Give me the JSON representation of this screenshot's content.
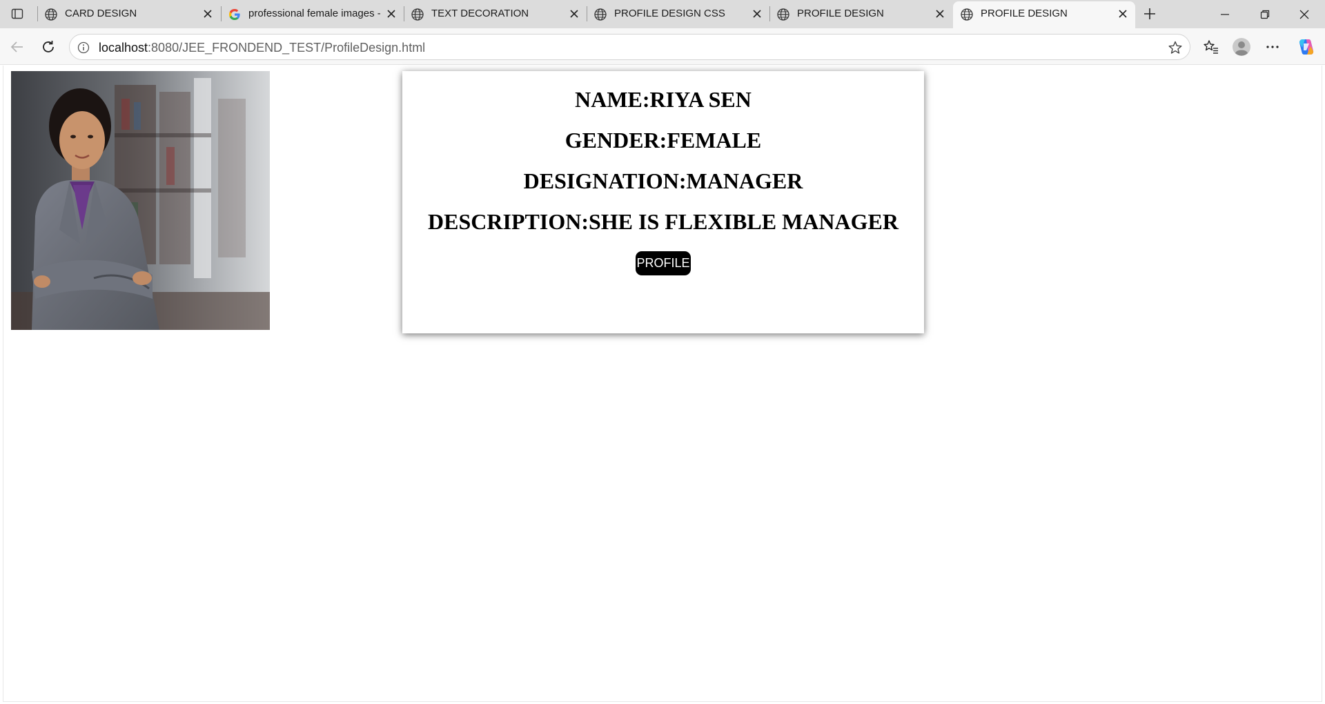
{
  "browser": {
    "tabs": [
      {
        "title": "CARD DESIGN",
        "icon": "globe-icon",
        "active": false
      },
      {
        "title": "professional female images - Google Search",
        "icon": "google-icon",
        "active": false
      },
      {
        "title": "TEXT DECORATION",
        "icon": "globe-icon",
        "active": false
      },
      {
        "title": "PROFILE DESIGN CSS",
        "icon": "globe-icon",
        "active": false
      },
      {
        "title": "PROFILE DESIGN",
        "icon": "globe-icon",
        "active": false
      },
      {
        "title": "PROFILE DESIGN",
        "icon": "globe-icon",
        "active": true
      }
    ],
    "address": {
      "host": "localhost",
      "path": ":8080/JEE_FRONDEND_TEST/ProfileDesign.html"
    }
  },
  "profile": {
    "name_line": "NAME:RIYA SEN",
    "gender_line": "GENDER:FEMALE",
    "designation_line": "DESIGNATION:MANAGER",
    "description_line": "DESCRIPTION:SHE IS FLEXIBLE MANAGER",
    "button_label": "PROFILE",
    "photo": "professional-woman-photo"
  },
  "colors": {
    "tabstrip_bg": "#dcdcdc",
    "toolbar_bg": "#f7f7f7",
    "button_bg": "#000000",
    "button_text": "#ffffff"
  }
}
